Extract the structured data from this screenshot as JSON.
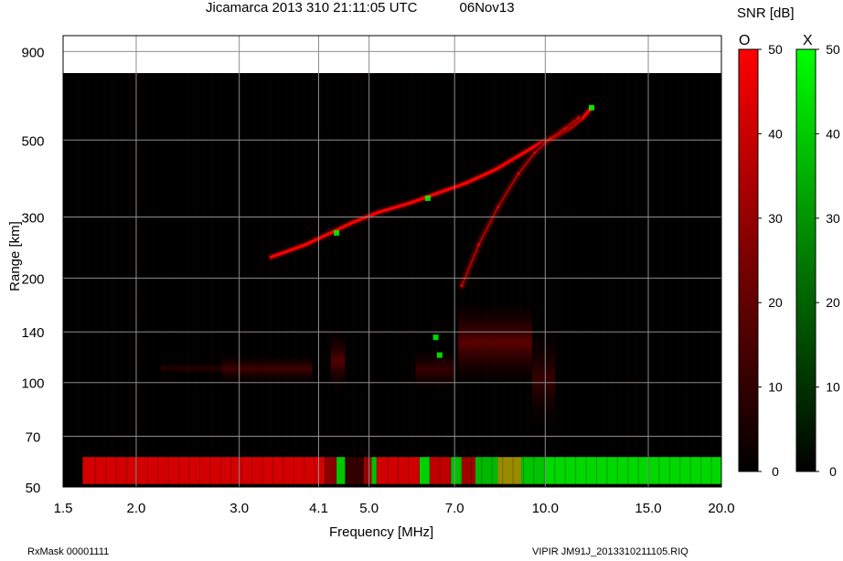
{
  "header": {
    "title": "Jicamarca 2013 310 21:11:05 UTC",
    "date": "06Nov13",
    "colorbar_title": "SNR [dB]"
  },
  "footer": {
    "left": "RxMask 00001111",
    "right": "VIPIR  JM91J_2013310211105.RIQ"
  },
  "colors": {
    "background": "#000000",
    "o_mode": "#ff0000",
    "x_mode": "#00ff00"
  },
  "chart_data": {
    "type": "heatmap",
    "title": "Jicamarca 2013 310 21:11:05 UTC",
    "xlabel": "Frequency [MHz]",
    "ylabel": "Range [km]",
    "x_scale": "log",
    "y_scale": "log",
    "xlim": [
      1.5,
      20.0
    ],
    "ylim": [
      50,
      1000
    ],
    "x_ticks": [
      1.5,
      2.0,
      3.0,
      4.1,
      5.0,
      7.0,
      10.0,
      15.0,
      20.0
    ],
    "x_tick_labels": [
      "1.5",
      "2.0",
      "3.0",
      "4.1",
      "5.0",
      "7.0",
      "10.0",
      "15.0",
      "20.0"
    ],
    "y_ticks": [
      50,
      70,
      100,
      140,
      200,
      300,
      500,
      900
    ],
    "y_tick_labels": [
      "50",
      "70",
      "100",
      "140",
      "200",
      "300",
      "500",
      "900"
    ],
    "data_top_range_km": 780,
    "grid": true,
    "colorbars": [
      {
        "label": "O",
        "color": "red",
        "range": [
          0,
          50
        ],
        "ticks": [
          0,
          10,
          20,
          30,
          40,
          50
        ],
        "tick_labels": [
          "0",
          "10",
          "20",
          "30",
          "40",
          "50"
        ]
      },
      {
        "label": "X",
        "color": "green",
        "range": [
          0,
          50
        ],
        "ticks": [
          0,
          10,
          20,
          30,
          40,
          50
        ],
        "tick_labels": [
          "0",
          "10",
          "20",
          "30",
          "40",
          "50"
        ]
      }
    ],
    "series": [
      {
        "name": "O",
        "color": "#ff0000",
        "points": [
          [
            3.4,
            230
          ],
          [
            3.9,
            250
          ],
          [
            4.3,
            270
          ],
          [
            4.7,
            290
          ],
          [
            5.2,
            310
          ],
          [
            5.9,
            330
          ],
          [
            6.5,
            350
          ],
          [
            7.3,
            375
          ],
          [
            8.2,
            410
          ],
          [
            9.0,
            450
          ],
          [
            9.8,
            490
          ],
          [
            10.4,
            510
          ],
          [
            11.0,
            540
          ],
          [
            11.6,
            580
          ],
          [
            12.0,
            620
          ]
        ]
      },
      {
        "name": "X",
        "color": "#00ff00",
        "points": [
          [
            4.4,
            270
          ],
          [
            6.3,
            340
          ],
          [
            6.5,
            135
          ],
          [
            6.6,
            120
          ],
          [
            12.0,
            620
          ]
        ]
      },
      {
        "name": "",
        "color": "#ff0000",
        "points": [
          [
            7.2,
            190
          ],
          [
            7.7,
            250
          ],
          [
            8.3,
            320
          ],
          [
            9.0,
            400
          ],
          [
            9.6,
            460
          ],
          [
            10.2,
            505
          ],
          [
            10.8,
            540
          ],
          [
            11.4,
            580
          ]
        ]
      }
    ]
  }
}
